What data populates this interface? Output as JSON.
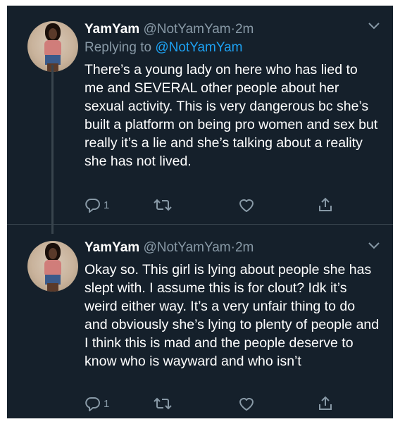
{
  "colors": {
    "background": "#15202b",
    "text": "#ffffff",
    "muted": "#8899a6",
    "link": "#1da1f2",
    "divider": "#38444d"
  },
  "tweets": [
    {
      "author_name": "YamYam",
      "author_handle": "@NotYamYam",
      "separator": "·",
      "time": "2m",
      "replying_label": "Replying to",
      "replying_to": "@NotYamYam",
      "text": "There’s a young lady on here who has lied to me and SEVERAL other people about her sexual activity. This is very dangerous bc she’s built a platform on being pro women and sex but really it’s a lie and she’s talking about a reality she has not lived.",
      "reply_count": "1",
      "icons": [
        "reply-icon",
        "retweet-icon",
        "like-icon",
        "share-icon",
        "chevron-down-icon"
      ]
    },
    {
      "author_name": "YamYam",
      "author_handle": "@NotYamYam",
      "separator": "·",
      "time": "2m",
      "text": "Okay so. This girl is lying about people she has slept with. I assume this is for clout? Idk it’s weird either way. It’s a very unfair thing to do and obviously she’s lying to plenty of people and I think this is mad and the people deserve to know who is wayward and who isn’t",
      "reply_count": "1",
      "icons": [
        "reply-icon",
        "retweet-icon",
        "like-icon",
        "share-icon",
        "chevron-down-icon"
      ]
    }
  ]
}
